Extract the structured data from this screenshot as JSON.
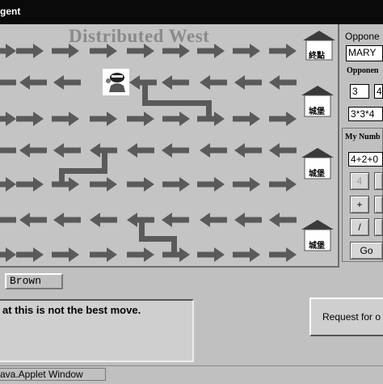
{
  "window": {
    "title": "gent"
  },
  "board": {
    "title": "Distributed West"
  },
  "houses": [
    {
      "label": "終點"
    },
    {
      "label": "城堡"
    },
    {
      "label": "城堡"
    },
    {
      "label": "城堡"
    }
  ],
  "side": {
    "opponent_label": "Oppone",
    "opponent_value": "MARY",
    "opponent_sub_label": "Opponen",
    "num_a": "3",
    "num_b": "4",
    "expr": "3*3*4",
    "my_number_label": "My Numb",
    "my_expr": "4+2+0",
    "buttons": {
      "num_4": "4",
      "plus": "+",
      "divide": "/",
      "go": "Go"
    }
  },
  "player_name": "Brown",
  "message": "at this is not the best move.",
  "request_button": "Request for o",
  "status": "ava.Applet Window",
  "colors": {
    "arrow": "#5a5a5a",
    "board": "#c4c4c4",
    "titlebar": "#0a0a0a"
  }
}
